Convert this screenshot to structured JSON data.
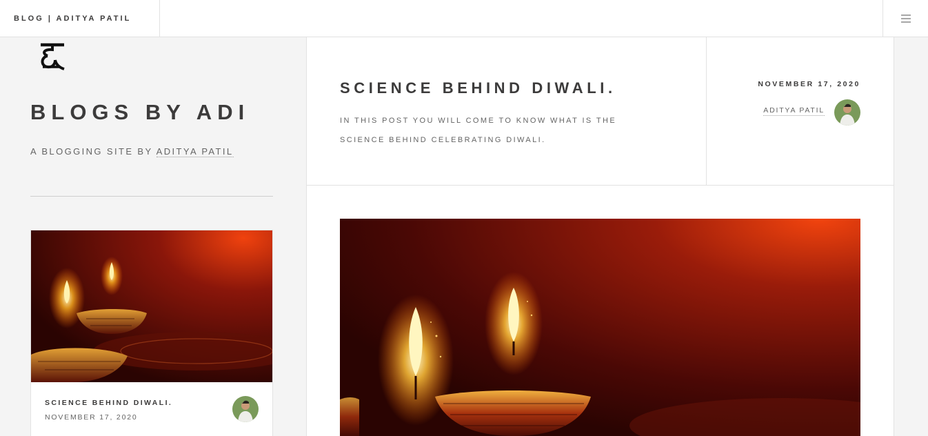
{
  "header": {
    "site_title": "BLOG | ADITYA PATIL",
    "menu_icon": "hamburger-icon"
  },
  "sidebar": {
    "logo_icon": "devanagari-letter-logo",
    "title": "BLOGS BY ADI",
    "subtitle_prefix": "A BLOGGING SITE BY ",
    "subtitle_link": "ADITYA PATIL",
    "mini_post": {
      "title": "SCIENCE BEHIND DIWALI.",
      "date": "NOVEMBER 17, 2020"
    }
  },
  "post": {
    "title": "SCIENCE BEHIND DIWALI.",
    "description": "IN THIS POST YOU WILL COME TO KNOW WHAT IS THE SCIENCE BEHIND CELEBRATING DIWALI.",
    "date": "NOVEMBER 17, 2020",
    "author": "ADITYA PATIL"
  },
  "colors": {
    "background": "#f4f4f4",
    "panel": "#ffffff",
    "text_dark": "#3c3b3b",
    "text_muted": "#646464",
    "diya_glow": "#e8420b"
  }
}
